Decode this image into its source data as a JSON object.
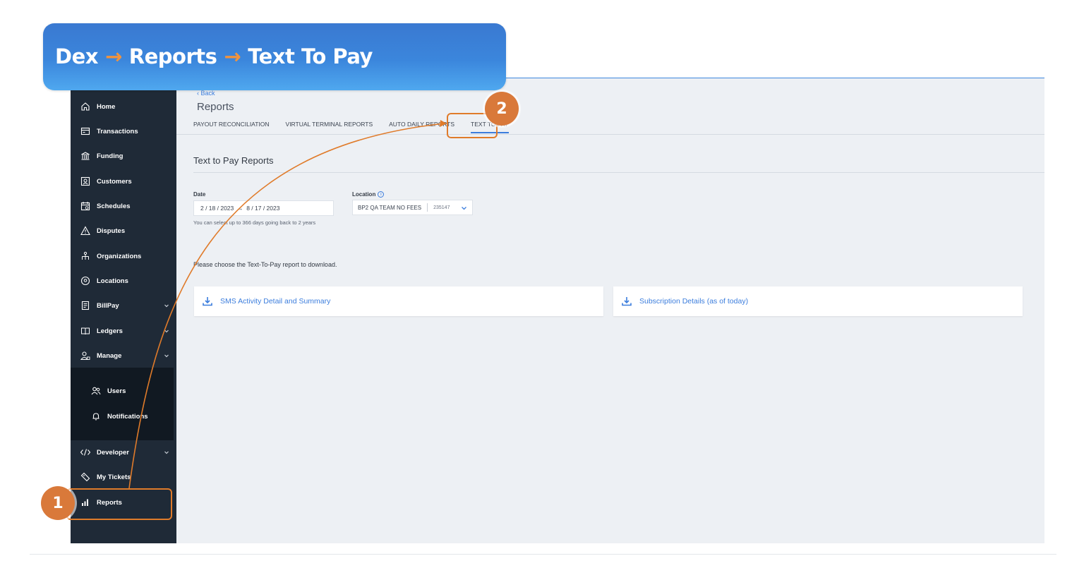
{
  "banner": {
    "part1": "Dex",
    "part2": "Reports",
    "part3": "Text To Pay",
    "separator": "→"
  },
  "sidebar": {
    "items": [
      {
        "label": "Home",
        "icon": "home-icon"
      },
      {
        "label": "Transactions",
        "icon": "transactions-icon"
      },
      {
        "label": "Funding",
        "icon": "bank-icon"
      },
      {
        "label": "Customers",
        "icon": "customers-icon"
      },
      {
        "label": "Schedules",
        "icon": "calendar-icon"
      },
      {
        "label": "Disputes",
        "icon": "warning-icon"
      },
      {
        "label": "Organizations",
        "icon": "org-chart-icon"
      },
      {
        "label": "Locations",
        "icon": "location-pin-icon"
      },
      {
        "label": "BillPay",
        "icon": "bill-icon"
      },
      {
        "label": "Ledgers",
        "icon": "ledger-icon"
      },
      {
        "label": "Manage",
        "icon": "manage-users-icon"
      }
    ],
    "sub_items": [
      {
        "label": "Users",
        "icon": "users-icon"
      },
      {
        "label": "Notifications",
        "icon": "bell-icon"
      }
    ],
    "bottom_items": [
      {
        "label": "Developer",
        "icon": "code-icon"
      },
      {
        "label": "My Tickets",
        "icon": "tickets-icon"
      },
      {
        "label": "Reports",
        "icon": "bar-chart-icon"
      }
    ]
  },
  "main": {
    "back_label": "‹ Back",
    "page_title": "Reports",
    "tabs": [
      {
        "label": "PAYOUT RECONCILIATION"
      },
      {
        "label": "VIRTUAL TERMINAL REPORTS"
      },
      {
        "label": "AUTO DAILY REPORTS"
      },
      {
        "label": "TEXT TO PAY",
        "active": true
      }
    ],
    "section_title": "Text to Pay Reports",
    "date": {
      "label": "Date",
      "value": "2 / 18 / 2023  →  8 / 17 / 2023",
      "hint": "You can select up to 366 days going back to 2 years"
    },
    "location": {
      "label": "Location",
      "name": "BP2 QA TEAM NO FEES",
      "id": "235147"
    },
    "prompt": "Please choose the Text-To-Pay report to download.",
    "reports": [
      {
        "label": "SMS Activity Detail and Summary"
      },
      {
        "label": "Subscription Details (as of today)"
      }
    ]
  },
  "callouts": {
    "step1": "1",
    "step2": "2"
  },
  "colors": {
    "accent": "#3b7ddd",
    "sidebar": "#1f2a37",
    "callout": "#d9793a",
    "banner": "#3b86dc"
  }
}
